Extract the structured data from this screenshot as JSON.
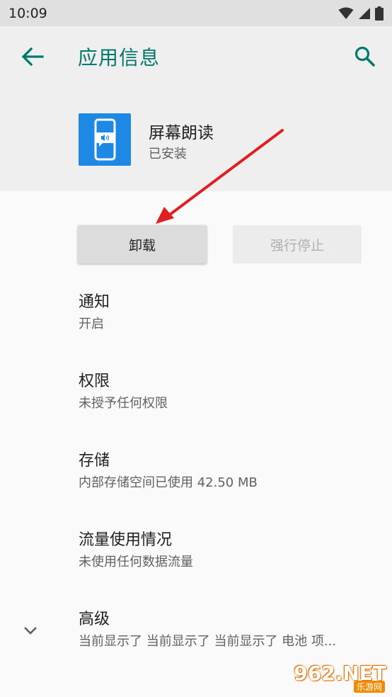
{
  "status_bar": {
    "time": "10:09"
  },
  "toolbar": {
    "title": "应用信息",
    "back_icon": "arrow-left-icon",
    "search_icon": "search-icon"
  },
  "app": {
    "name": "屏幕朗读",
    "status": "已安装",
    "icon": "screen-reader-icon",
    "icon_color": "#1e88e5"
  },
  "actions": {
    "uninstall_label": "卸载",
    "force_stop_label": "强行停止"
  },
  "settings": [
    {
      "title": "通知",
      "summary": "开启"
    },
    {
      "title": "权限",
      "summary": "未授予任何权限"
    },
    {
      "title": "存储",
      "summary": "内部存储空间已使用 42.50 MB"
    },
    {
      "title": "流量使用情况",
      "summary": "未使用任何数据流量"
    },
    {
      "title": "高级",
      "summary": "当前显示了 当前显示了 当前显示了 电池 项..."
    }
  ],
  "watermark": {
    "text": "962.NET",
    "sub": "乐游网"
  },
  "colors": {
    "accent": "#00796b",
    "annotation": "#e02020"
  }
}
